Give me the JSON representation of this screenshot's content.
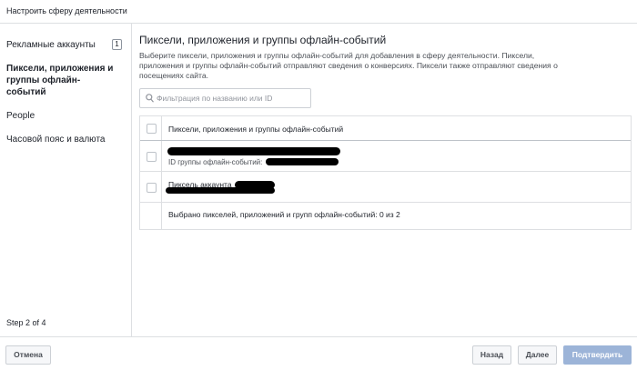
{
  "header": {
    "title": "Настроить сферу деятельности"
  },
  "sidebar": {
    "items": [
      {
        "label": "Рекламные аккаунты",
        "badge": "1"
      },
      {
        "label_lines": [
          "Пиксели, приложения и",
          "группы офлайн-",
          "событий"
        ],
        "active": true
      },
      {
        "label": "People"
      },
      {
        "label": "Часовой пояс и валюта"
      }
    ],
    "step": "Step 2 of 4"
  },
  "main": {
    "title": "Пиксели, приложения и группы офлайн-событий",
    "description_lines": [
      "Выберите пиксели, приложения и группы офлайн-событий для добавления в сферу деятельности. Пиксели,",
      "приложения и группы офлайн-событий отправляют сведения о конверсиях. Пиксели также отправляют сведения о",
      "посещениях сайта."
    ],
    "search": {
      "placeholder": "Фильтрация по названию или ID",
      "value": ""
    },
    "table": {
      "header": "Пиксели, приложения и группы офлайн-событий",
      "rows": [
        {
          "subtitle": "ID группы офлайн-событий:",
          "checked": false
        },
        {
          "title": "Пиксель аккаунта",
          "checked": false
        }
      ],
      "footer": "Выбрано пикселей, приложений и групп офлайн-событий: 0 из 2"
    }
  },
  "footer": {
    "cancel": "Отмена",
    "back": "Назад",
    "next": "Далее",
    "confirm": "Подтвердить"
  }
}
